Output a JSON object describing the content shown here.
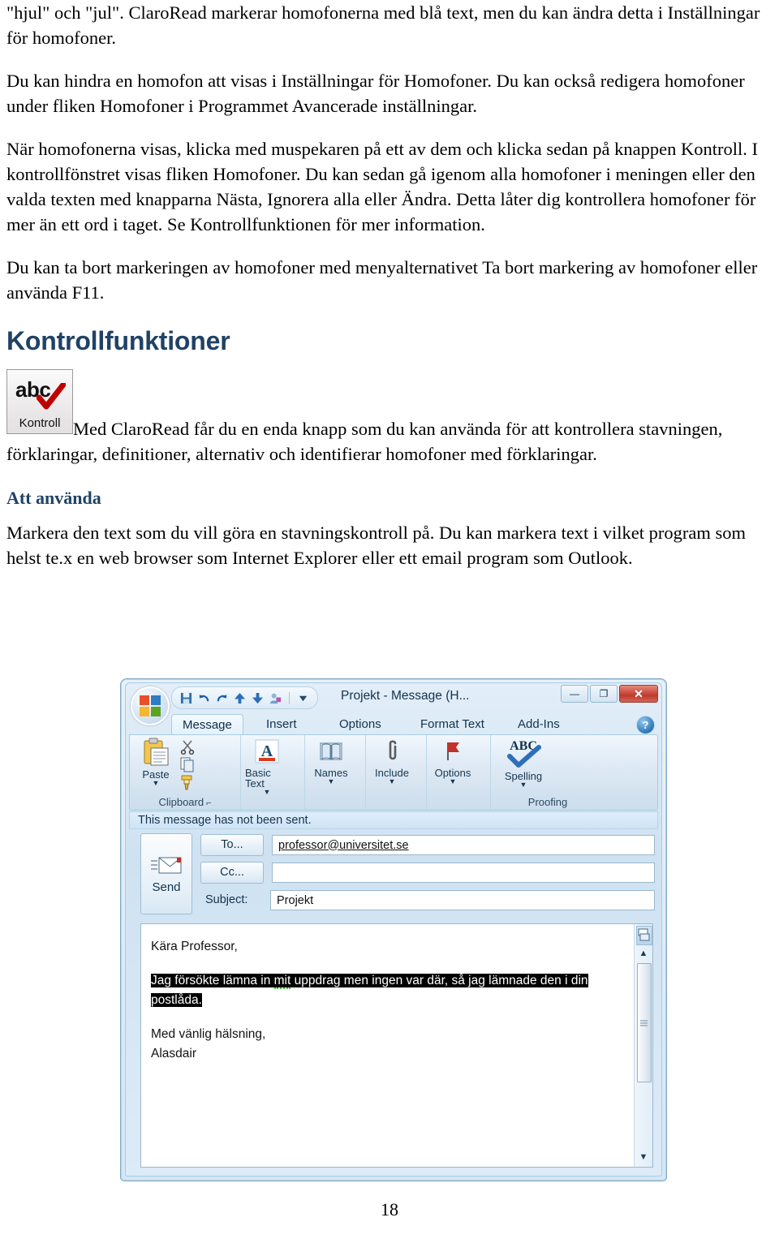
{
  "document": {
    "paragraphs": [
      "\"hjul\" och \"jul\". ClaroRead markerar homofonerna med blå text, men du kan ändra detta i Inställningar för homofoner.",
      "Du kan hindra en homofon att visas i Inställningar för Homofoner. Du kan också redigera homofoner under fliken Homofoner i Programmet Avancerade inställningar.",
      "När homofonerna visas, klicka med muspekaren på ett av dem och klicka sedan på knappen Kontroll. I kontrollfönstret visas fliken Homofoner. Du kan sedan gå igenom alla homofoner i meningen eller den valda texten med knapparna Nästa, Ignorera alla eller Ändra. Detta låter dig kontrollera homofoner för mer än ett ord i taget. Se Kontrollfunktionen för mer information.",
      "Du kan ta bort markeringen av homofoner med menyalternativet Ta bort markering av homofoner eller använda F11."
    ],
    "section_heading": "Kontrollfunktioner",
    "kontroll_icon": {
      "abc_text": "abc",
      "label": "Kontroll"
    },
    "intro_after_icon": "Med ClaroRead får du en enda knapp som du kan använda för att kontrollera stavningen, förklaringar, definitioner, alternativ och identifierar homofoner med förklaringar.",
    "sub_heading": "Att använda",
    "usage_paragraph": "Markera den text som du vill göra en stavningskontroll på. Du kan markera text i vilket program som helst te.x en web browser som Internet Explorer eller ett email program som Outlook.",
    "page_number": "18",
    "colors": {
      "heading_blue": "#1F4266",
      "body_black": "#000000"
    }
  },
  "outlook": {
    "titlebar": {
      "title": "Projekt - Message (H...",
      "orb_name": "office-orb",
      "quick_access": [
        {
          "name": "save-icon",
          "tip": "Save"
        },
        {
          "name": "undo-icon",
          "tip": "Undo"
        },
        {
          "name": "redo-icon",
          "tip": "Redo"
        },
        {
          "name": "previous-item-icon",
          "tip": "Previous Item"
        },
        {
          "name": "next-item-icon",
          "tip": "Next Item"
        },
        {
          "name": "address-book-icon",
          "tip": "Address Book"
        },
        {
          "name": "customize-qat-icon",
          "tip": "Customize Quick Access Toolbar"
        }
      ],
      "window_buttons": {
        "minimize": "—",
        "maximize": "❐",
        "close": "✕"
      }
    },
    "tabs": [
      {
        "label": "Message",
        "active": true
      },
      {
        "label": "Insert",
        "active": false
      },
      {
        "label": "Options",
        "active": false
      },
      {
        "label": "Format Text",
        "active": false
      },
      {
        "label": "Add-Ins",
        "active": false
      }
    ],
    "help_glyph": "?",
    "ribbon": {
      "groups": [
        {
          "label": "Clipboard",
          "dialog_launcher": "⌐",
          "buttons": [
            {
              "label": "Paste",
              "icon": "paste-icon",
              "caret": "▼"
            },
            {
              "label": "",
              "icon": "cut-icon",
              "caret": ""
            },
            {
              "label": "",
              "icon": "copy-icon",
              "caret": ""
            },
            {
              "label": "",
              "icon": "format-painter-icon",
              "caret": ""
            }
          ]
        },
        {
          "label": "",
          "buttons": [
            {
              "label": "Basic Text",
              "icon": "basic-text-icon",
              "caret": "▼"
            }
          ]
        },
        {
          "label": "",
          "buttons": [
            {
              "label": "Names",
              "icon": "names-icon",
              "caret": "▼"
            }
          ]
        },
        {
          "label": "",
          "buttons": [
            {
              "label": "Include",
              "icon": "include-attach-icon",
              "caret": "▼"
            }
          ]
        },
        {
          "label": "",
          "buttons": [
            {
              "label": "Options",
              "icon": "options-flag-icon",
              "caret": "▼"
            }
          ]
        },
        {
          "label": "Proofing",
          "buttons": [
            {
              "label": "Spelling",
              "icon": "spelling-abc-check-icon",
              "caret": "▼"
            }
          ]
        }
      ]
    },
    "info_bar": "This message has not been sent.",
    "send_button": {
      "label": "Send",
      "icon": "send-envelope-icon"
    },
    "fields": {
      "to": {
        "button_label": "To...",
        "value": "professor@universitet.se"
      },
      "cc": {
        "button_label": "Cc...",
        "value": ""
      },
      "subject": {
        "label": "Subject:",
        "value": "Projekt"
      }
    },
    "message_body": {
      "greeting": "Kära Professor,",
      "selected_text_part1": "Jag försökte lämna in ",
      "selected_misspelled": "mit",
      "selected_text_part2": " uppdrag men ingen var där, så jag lämnade den i din postlåda.",
      "signoff": "Med vänlig hälsning,",
      "signature": "Alasdair"
    },
    "scrollbar": {
      "top_icon": "split-window-icon",
      "up_arrow": "▲",
      "down_arrow": "▼"
    }
  }
}
